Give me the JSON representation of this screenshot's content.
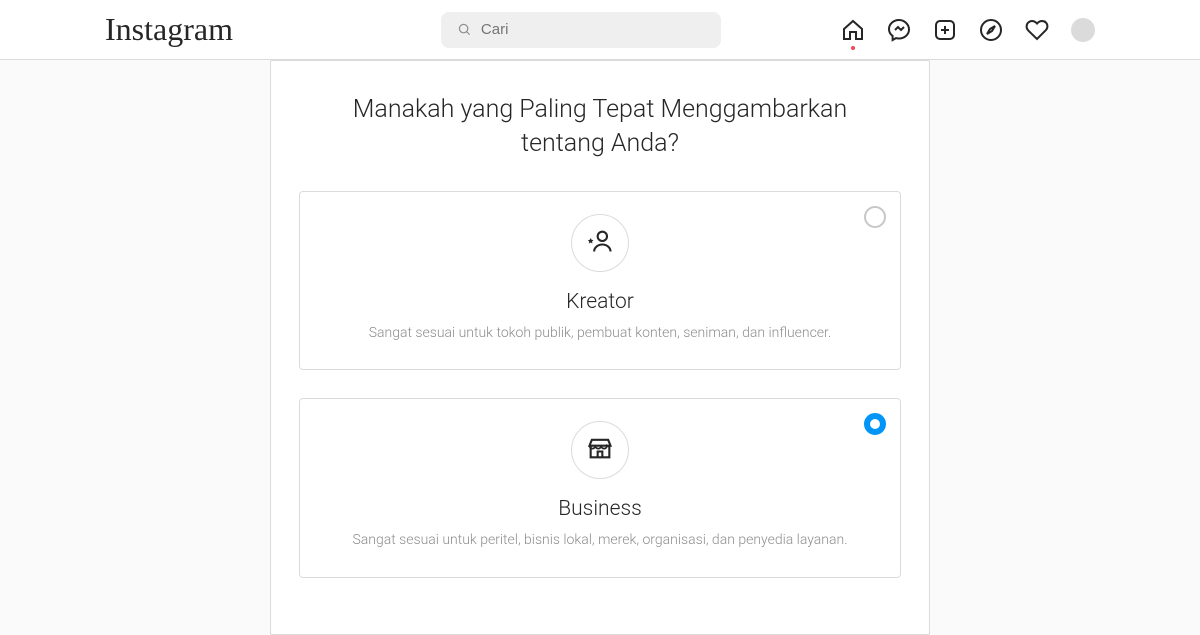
{
  "header": {
    "logo_text": "Instagram",
    "search_placeholder": "Cari"
  },
  "nav": {
    "home": "home-icon",
    "messenger": "messenger-icon",
    "new_post": "new-post-icon",
    "explore": "explore-icon",
    "activity": "heart-icon",
    "avatar": "avatar"
  },
  "page": {
    "title": "Manakah yang Paling Tepat Menggambarkan tentang Anda?"
  },
  "options": [
    {
      "id": "kreator",
      "title": "Kreator",
      "description": "Sangat sesuai untuk tokoh publik, pembuat konten, seniman, dan influencer.",
      "selected": false
    },
    {
      "id": "business",
      "title": "Business",
      "description": "Sangat sesuai untuk peritel, bisnis lokal, merek, organisasi, dan penyedia layanan.",
      "selected": true
    }
  ]
}
